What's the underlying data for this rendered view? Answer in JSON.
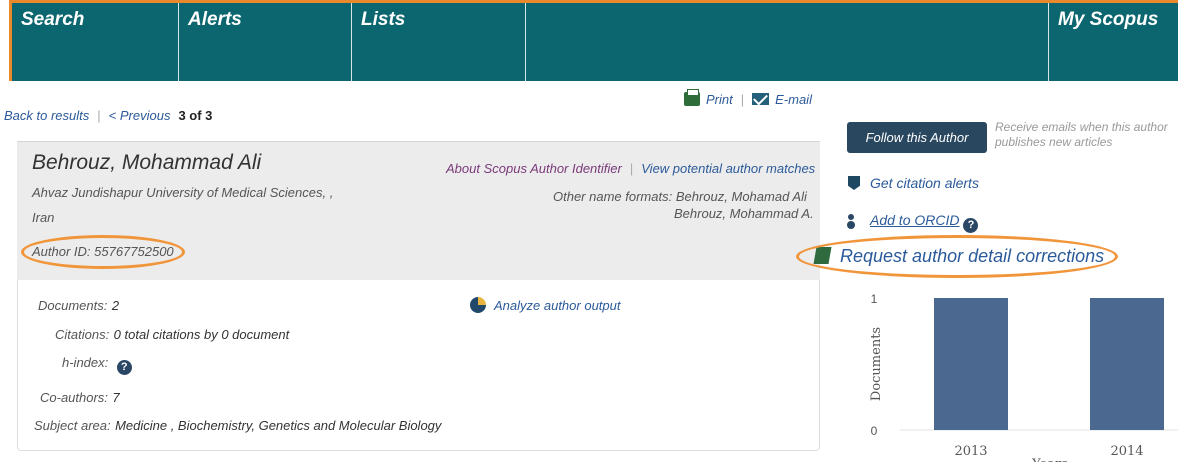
{
  "nav": {
    "search": "Search",
    "alerts": "Alerts",
    "lists": "Lists",
    "my_scopus": "My Scopus"
  },
  "breadcrumb": {
    "back": "Back to results",
    "previous": "< Previous",
    "position": "3 of 3"
  },
  "actions": {
    "print": "Print",
    "email": "E-mail"
  },
  "author": {
    "name": "Behrouz, Mohammad Ali",
    "affiliation": "Ahvaz Jundishapur University of Medical Sciences, ,",
    "country": "Iran",
    "author_id": "Author ID: 55767752500",
    "about_link": "About Scopus Author Identifier",
    "matches_link": "View potential author matches",
    "other_formats_label": "Other name formats:",
    "other_formats": [
      "Behrouz, Mohamad Ali",
      "Behrouz, Mohammad A."
    ]
  },
  "metrics": {
    "documents_label": "Documents:",
    "documents_value": "2",
    "citations_label": "Citations:",
    "citations_value": "0  total citations by 0 document",
    "hindex_label": "h-index:",
    "coauthors_label": "Co-authors:",
    "coauthors_value": "7",
    "subject_label": "Subject area:",
    "subject_value": "Medicine ,  Biochemistry, Genetics and Molecular Biology",
    "analyze_link": "Analyze author output"
  },
  "sidebar": {
    "follow_button": "Follow this Author",
    "follow_note": "Receive emails when this author publishes new articles",
    "citation_alerts": "Get citation alerts",
    "add_orcid": "Add to ORCID",
    "request_corrections": "Request author detail corrections"
  },
  "icons": [
    "print-icon",
    "email-icon",
    "pie-chart-icon",
    "help-icon",
    "flag-icon",
    "person-icon",
    "edit-icon"
  ],
  "colors": {
    "nav_bg": "#0b6670",
    "highlight": "#f1953a",
    "bar": "#4a6890",
    "link": "#2b5a9a"
  },
  "chart_data": {
    "type": "bar",
    "categories": [
      "2013",
      "2014"
    ],
    "values": [
      1,
      1
    ],
    "ylabel": "Documents",
    "xlabel": "Years",
    "yticks": [
      "0",
      "1"
    ],
    "ylim": [
      0,
      1
    ]
  }
}
